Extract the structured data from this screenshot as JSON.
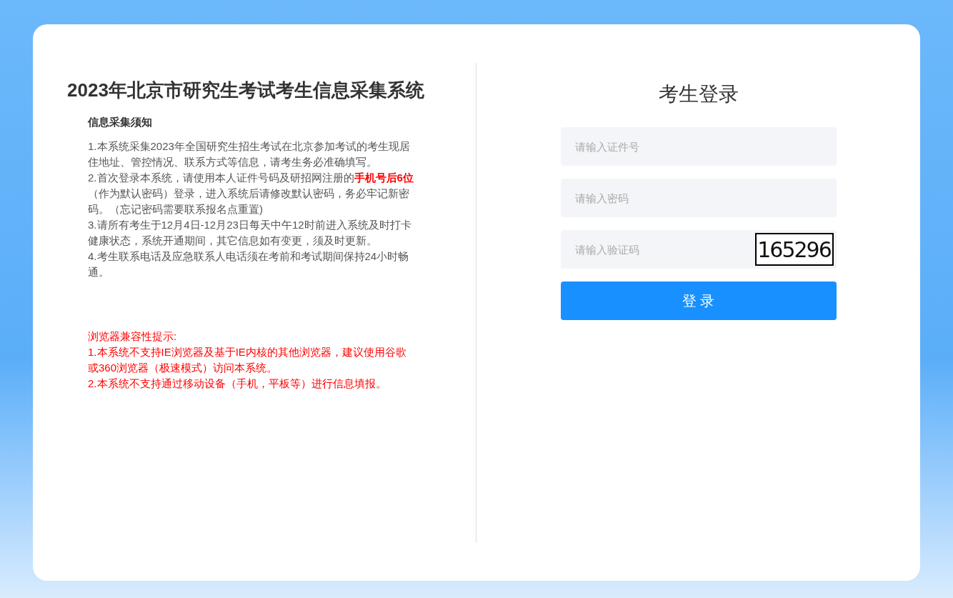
{
  "page_title": "2023年北京市研究生考试考生信息采集系统",
  "notice": {
    "heading": "信息采集须知",
    "items": [
      "1.本系统采集2023年全国研究生招生考试在北京参加考试的考生现居住地址、管控情况、联系方式等信息，请考生务必准确填写。",
      "2.首次登录本系统，请使用本人证件号码及研招网注册的**手机号后6位**（作为默认密码）登录，进入系统后请修改默认密码，务必牢记新密码。（忘记密码需要联系报名点重置)",
      "3.请所有考生于12月4日-12月23日每天中午12时前进入系统及时打卡健康状态，系统开通期间，其它信息如有变更，须及时更新。",
      "4.考生联系电话及应急联系人电话须在考前和考试期间保持24小时畅通。"
    ]
  },
  "browser_tips": {
    "heading": "浏览器兼容性提示:",
    "items": [
      "1.本系统不支持IE浏览器及基于IE内核的其他浏览器，建议使用谷歌或360浏览器（极速模式）访问本系统。",
      "2.本系统不支持通过移动设备（手机，平板等）进行信息填报。"
    ]
  },
  "login": {
    "title": "考生登录",
    "fields": [
      {
        "kind": "text",
        "placeholder": "请输入证件号"
      },
      {
        "kind": "password",
        "placeholder": "请输入密码"
      },
      {
        "kind": "captcha",
        "placeholder": "请输入验证码",
        "captcha": "165296"
      }
    ],
    "button": "登 录"
  }
}
